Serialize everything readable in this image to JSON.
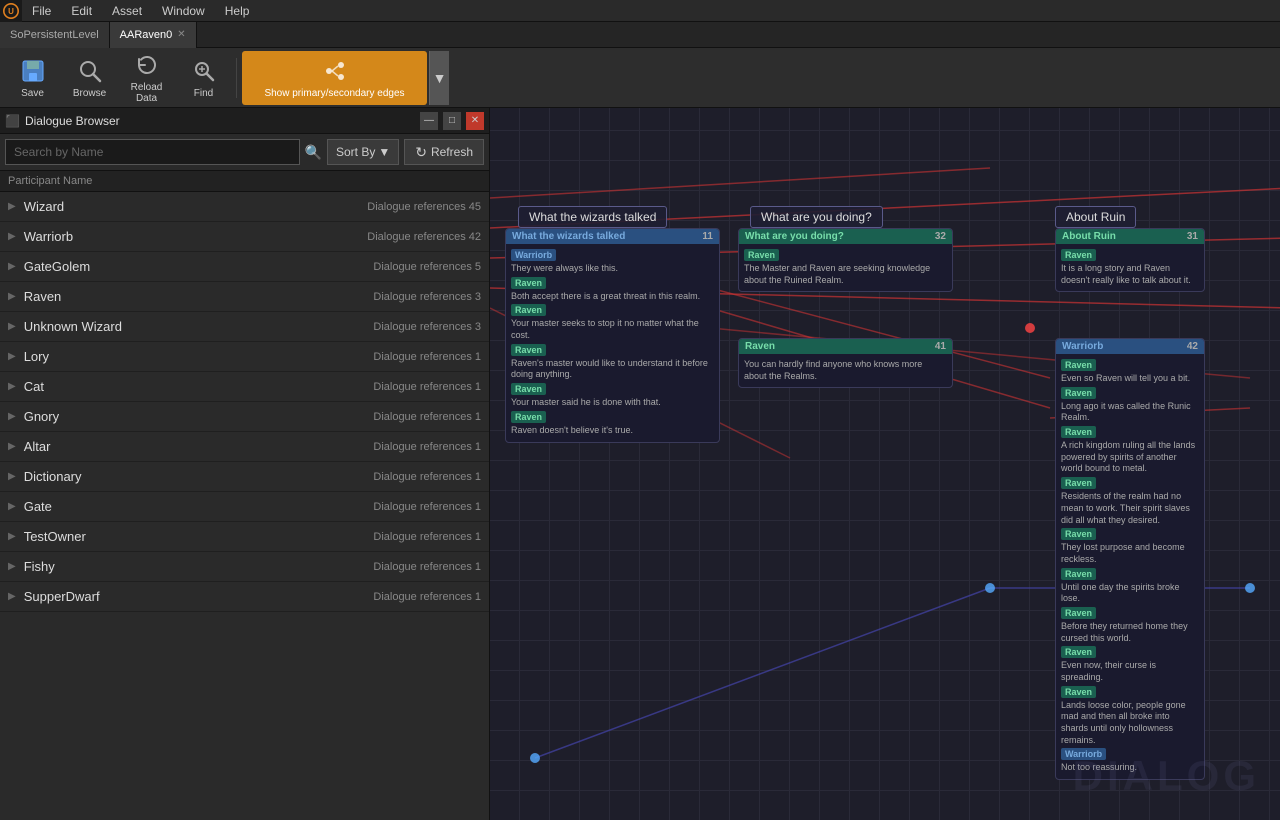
{
  "app": {
    "logo": "U",
    "tabs": [
      {
        "label": "SoPersistentLevel",
        "active": false
      },
      {
        "label": "AARaven0",
        "active": true
      }
    ]
  },
  "menu": {
    "items": [
      "File",
      "Edit",
      "Asset",
      "Window",
      "Help"
    ]
  },
  "toolbar": {
    "save_label": "Save",
    "browse_label": "Browse",
    "reload_label": "Reload Data",
    "find_label": "Find",
    "show_edges_label": "Show primary/secondary edges"
  },
  "dialogue_browser": {
    "title": "Dialogue Browser",
    "search_placeholder": "Search by Name",
    "sort_label": "Sort By",
    "refresh_label": "Refresh",
    "header": "Participant Name",
    "items": [
      {
        "name": "Wizard",
        "refs": "Dialogue references 45"
      },
      {
        "name": "Warriorb",
        "refs": "Dialogue references 42"
      },
      {
        "name": "GateGolem",
        "refs": "Dialogue references 5"
      },
      {
        "name": "Raven",
        "refs": "Dialogue references 3"
      },
      {
        "name": "Unknown Wizard",
        "refs": "Dialogue references 3"
      },
      {
        "name": "Lory",
        "refs": "Dialogue references 1"
      },
      {
        "name": "Cat",
        "refs": "Dialogue references 1"
      },
      {
        "name": "Gnory",
        "refs": "Dialogue references 1"
      },
      {
        "name": "Altar",
        "refs": "Dialogue references 1"
      },
      {
        "name": "Dictionary",
        "refs": "Dialogue references 1"
      },
      {
        "name": "Gate",
        "refs": "Dialogue references 1"
      },
      {
        "name": "TestOwner",
        "refs": "Dialogue references 1"
      },
      {
        "name": "Fishy",
        "refs": "Dialogue references 1"
      },
      {
        "name": "SupperDwarf",
        "refs": "Dialogue references 1"
      }
    ]
  },
  "canvas": {
    "nodes": {
      "what_wizards_label": "What the wizards talked",
      "what_wizards_card_title": "What the wizards talked",
      "what_doing_label": "What are you doing?",
      "what_doing_card_title": "What are you doing?",
      "about_ruin_label": "About Ruin",
      "about_ruin_card_title": "About Ruin"
    },
    "watermark": "DIALOG"
  }
}
